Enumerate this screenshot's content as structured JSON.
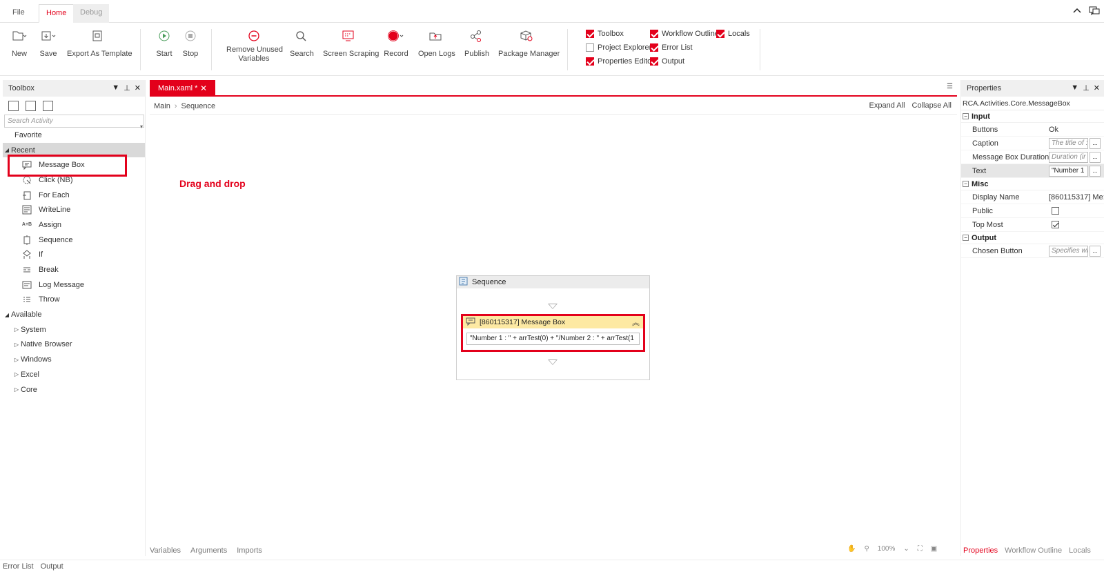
{
  "menu": {
    "tabs": [
      "File",
      "Home",
      "Debug"
    ],
    "active": "Home"
  },
  "ribbon": {
    "buttons": [
      "New",
      "Save",
      "Export As Template",
      "Start",
      "Stop",
      "Remove Unused Variables",
      "Search",
      "Screen Scraping",
      "Record",
      "Open Logs",
      "Publish",
      "Package Manager"
    ],
    "remove_line1": "Remove Unused",
    "remove_line2": "Variables",
    "panels": [
      {
        "label": "Toolbox",
        "checked": true
      },
      {
        "label": "Workflow Outline",
        "checked": true
      },
      {
        "label": "Locals",
        "checked": true
      },
      {
        "label": "Project Explorer",
        "checked": false
      },
      {
        "label": "Error List",
        "checked": true
      },
      {
        "label": "Properties Editor",
        "checked": true
      },
      {
        "label": "Output",
        "checked": true
      }
    ]
  },
  "toolbox": {
    "title": "Toolbox",
    "search_placeholder": "Search Activity",
    "favorite": "Favorite",
    "recent": "Recent",
    "recent_items": [
      "Message Box",
      "Click (NB)",
      "For Each",
      "WriteLine",
      "Assign",
      "Sequence",
      "If",
      "Break",
      "Log Message",
      "Throw"
    ],
    "available": "Available",
    "available_groups": [
      "System",
      "Native Browser",
      "Windows",
      "Excel",
      "Core"
    ]
  },
  "document": {
    "tab_label": "Main.xaml *",
    "breadcrumb": [
      "Main",
      "Sequence"
    ],
    "expand_all": "Expand All",
    "collapse_all": "Collapse All",
    "annotation": "Drag and drop",
    "sequence_title": "Sequence",
    "messagebox_title": "[860115317] Message Box",
    "messagebox_text": "\"Number 1 : \" + arrTest(0) + \"/Number 2 : \" + arrTest(1",
    "bottom_tabs": [
      "Variables",
      "Arguments",
      "Imports"
    ],
    "zoom": "100%"
  },
  "properties": {
    "title": "Properties",
    "type_name": "RCA.Activities.Core.MessageBox",
    "input_label": "Input",
    "buttons_label": "Buttons",
    "buttons_value": "Ok",
    "caption_label": "Caption",
    "caption_placeholder": "The title of :",
    "duration_label": "Message Box Duration",
    "duration_placeholder": "Duration (ir",
    "text_label": "Text",
    "text_value": "\"Number 1",
    "misc_label": "Misc",
    "display_name_label": "Display Name",
    "display_name_value": "[860115317] Me:",
    "public_label": "Public",
    "public_checked": false,
    "topmost_label": "Top Most",
    "topmost_checked": true,
    "output_label": "Output",
    "chosen_label": "Chosen Button",
    "chosen_placeholder": "Specifies wh",
    "tabs": [
      "Properties",
      "Workflow Outline",
      "Locals"
    ]
  },
  "status_bar": [
    "Error List",
    "Output"
  ],
  "colors": {
    "accent": "#e3001b",
    "highlight_yellow": "#fde9a3"
  }
}
